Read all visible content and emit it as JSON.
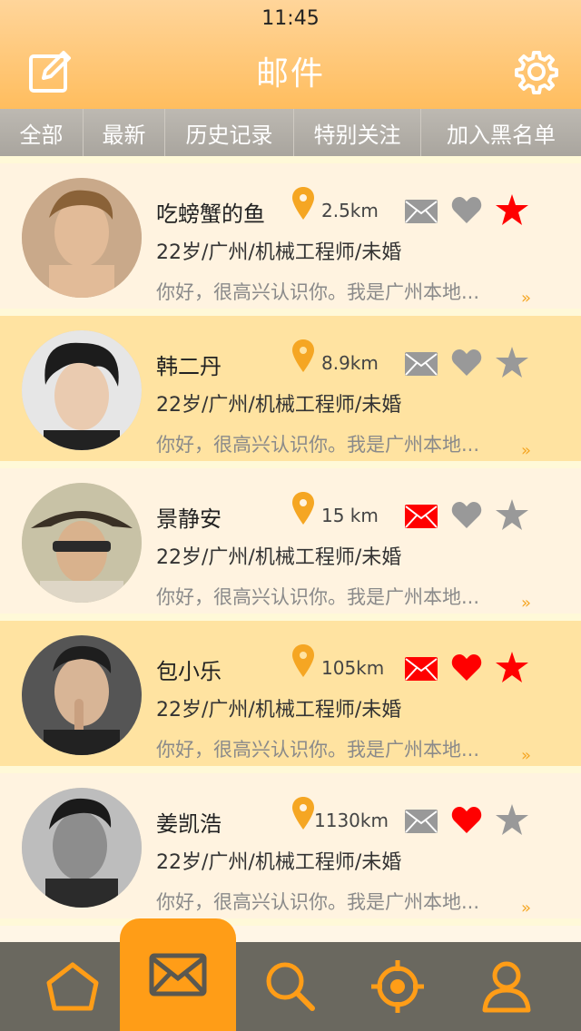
{
  "status_bar": {
    "time": "11:45"
  },
  "header": {
    "title": "邮件",
    "left_icon": "compose-icon",
    "right_icon": "gear-icon"
  },
  "tabs": [
    {
      "label": "全部"
    },
    {
      "label": "最新"
    },
    {
      "label": "历史记录"
    },
    {
      "label": "特别关注"
    },
    {
      "label": "加入黑名单"
    }
  ],
  "colors": {
    "accent": "#ff9d17",
    "header": "#ffc46b",
    "red": "#ff0000",
    "gray_icon": "#999999",
    "row_light": "#fff3e0",
    "row_dark": "#ffe3a1"
  },
  "mails": [
    {
      "name": "吃螃蟹的鱼",
      "distance": "2.5km",
      "info": "22岁/广州/机械工程师/未婚",
      "message": "你好，很高兴认识你。我是广州本地...",
      "more": "»",
      "mail_unread": false,
      "liked": false,
      "starred": true
    },
    {
      "name": "韩二丹",
      "distance": "8.9km",
      "info": "22岁/广州/机械工程师/未婚",
      "message": "你好，很高兴认识你。我是广州本地...",
      "more": "»",
      "mail_unread": false,
      "liked": false,
      "starred": false
    },
    {
      "name": "景静安",
      "distance": "15 km",
      "info": "22岁/广州/机械工程师/未婚",
      "message": "你好，很高兴认识你。我是广州本地...",
      "more": "»",
      "mail_unread": true,
      "liked": false,
      "starred": false
    },
    {
      "name": "包小乐",
      "distance": "105km",
      "info": "22岁/广州/机械工程师/未婚",
      "message": "你好，很高兴认识你。我是广州本地...",
      "more": "»",
      "mail_unread": true,
      "liked": true,
      "starred": true
    },
    {
      "name": "姜凯浩",
      "distance": "1130km",
      "info": "22岁/广州/机械工程师/未婚",
      "message": "你好，很高兴认识你。我是广州本地...",
      "more": "»",
      "mail_unread": false,
      "liked": true,
      "starred": false
    }
  ],
  "tabbar": [
    {
      "icon": "home-icon",
      "active": false
    },
    {
      "icon": "mail-icon",
      "active": true
    },
    {
      "icon": "search-icon",
      "active": false
    },
    {
      "icon": "target-icon",
      "active": false
    },
    {
      "icon": "profile-icon",
      "active": false
    }
  ]
}
